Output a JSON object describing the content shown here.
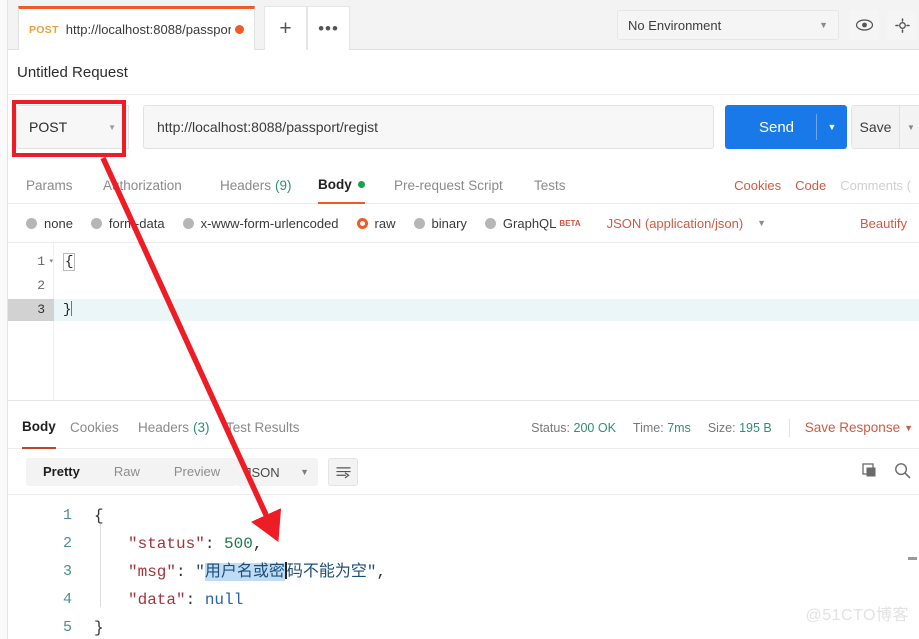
{
  "window": {
    "tab": {
      "method": "POST",
      "url": "http://localhost:8088/passport...",
      "unsaved_dot": "unsaved"
    },
    "new_tab_label": "+",
    "more_tabs_label": "•••",
    "environment": {
      "selected": "No Environment",
      "caret": "▼"
    },
    "eye_icon": "eye-icon",
    "gear_icon": "gear-icon"
  },
  "request": {
    "title": "Untitled Request",
    "method": "POST",
    "method_caret": "▼",
    "url": "http://localhost:8088/passport/regist",
    "send_label": "Send",
    "send_caret": "▼",
    "save_label": "Save",
    "save_caret": "▼",
    "tabs": [
      {
        "label": "Params",
        "active": false
      },
      {
        "label": "Authorization",
        "active": false
      },
      {
        "label": "Headers",
        "count": "(9)",
        "active": false
      },
      {
        "label": "Body",
        "active": true,
        "dot": true
      },
      {
        "label": "Pre-request Script",
        "active": false
      },
      {
        "label": "Tests",
        "active": false
      }
    ],
    "tab_right": {
      "cookies": "Cookies",
      "code": "Code",
      "comments": "Comments ("
    },
    "body_types": [
      {
        "label": "none",
        "selected": false
      },
      {
        "label": "form-data",
        "selected": false
      },
      {
        "label": "x-www-form-urlencoded",
        "selected": false
      },
      {
        "label": "raw",
        "selected": true
      },
      {
        "label": "binary",
        "selected": false
      },
      {
        "label": "GraphQL",
        "selected": false,
        "badge": "BETA"
      }
    ],
    "content_type": "JSON (application/json)",
    "content_type_caret": "▼",
    "beautify_label": "Beautify",
    "editor": {
      "lines": [
        {
          "no": "1",
          "fold": "▾",
          "text": "{",
          "current": false
        },
        {
          "no": "2",
          "text": "",
          "current": false
        },
        {
          "no": "3",
          "text": "}",
          "current": true
        }
      ]
    }
  },
  "response": {
    "tabs": [
      {
        "label": "Body",
        "active": true
      },
      {
        "label": "Cookies",
        "active": false
      },
      {
        "label": "Headers",
        "count": "(3)",
        "active": false
      },
      {
        "label": "Test Results",
        "active": false
      }
    ],
    "meta": {
      "status_label": "Status:",
      "status_value": "200 OK",
      "time_label": "Time:",
      "time_value": "7ms",
      "size_label": "Size:",
      "size_value": "195 B",
      "save_response": "Save Response",
      "save_response_caret": "▼"
    },
    "view_modes": [
      {
        "label": "Pretty",
        "active": true
      },
      {
        "label": "Raw",
        "active": false
      },
      {
        "label": "Preview",
        "active": false
      }
    ],
    "format": "JSON",
    "format_caret": "▼",
    "wrap_icon": "word-wrap-icon",
    "copy_icon": "copy-icon",
    "search_icon": "search-icon",
    "body": {
      "lines": [
        {
          "no": "1",
          "segments": [
            {
              "t": "{",
              "c": "p"
            }
          ]
        },
        {
          "no": "2",
          "indent": true,
          "segments": [
            {
              "t": "\"status\"",
              "c": "k"
            },
            {
              "t": ": ",
              "c": "p"
            },
            {
              "t": "500",
              "c": "num"
            },
            {
              "t": ",",
              "c": "p"
            }
          ]
        },
        {
          "no": "3",
          "indent": true,
          "segments": [
            {
              "t": "\"msg\"",
              "c": "k"
            },
            {
              "t": ": ",
              "c": "p"
            },
            {
              "t": "\"",
              "c": "strv"
            },
            {
              "t": "用户名或密",
              "c": "strv",
              "highlight": true
            },
            {
              "t": "码不能为空",
              "c": "strv"
            },
            {
              "t": "\"",
              "c": "strv"
            },
            {
              "t": ",",
              "c": "p"
            }
          ]
        },
        {
          "no": "4",
          "indent": true,
          "segments": [
            {
              "t": "\"data\"",
              "c": "k"
            },
            {
              "t": ": ",
              "c": "p"
            },
            {
              "t": "null",
              "c": "nullv"
            }
          ]
        },
        {
          "no": "5",
          "segments": [
            {
              "t": "}",
              "c": "p"
            }
          ]
        }
      ]
    }
  },
  "annotations": {
    "highlight_box": "red-rectangle-around-method-selector",
    "arrow": "red-arrow-from-method-to-status-500",
    "arrow_color": "#ee1c25"
  },
  "watermark": "@51CTO博客"
}
